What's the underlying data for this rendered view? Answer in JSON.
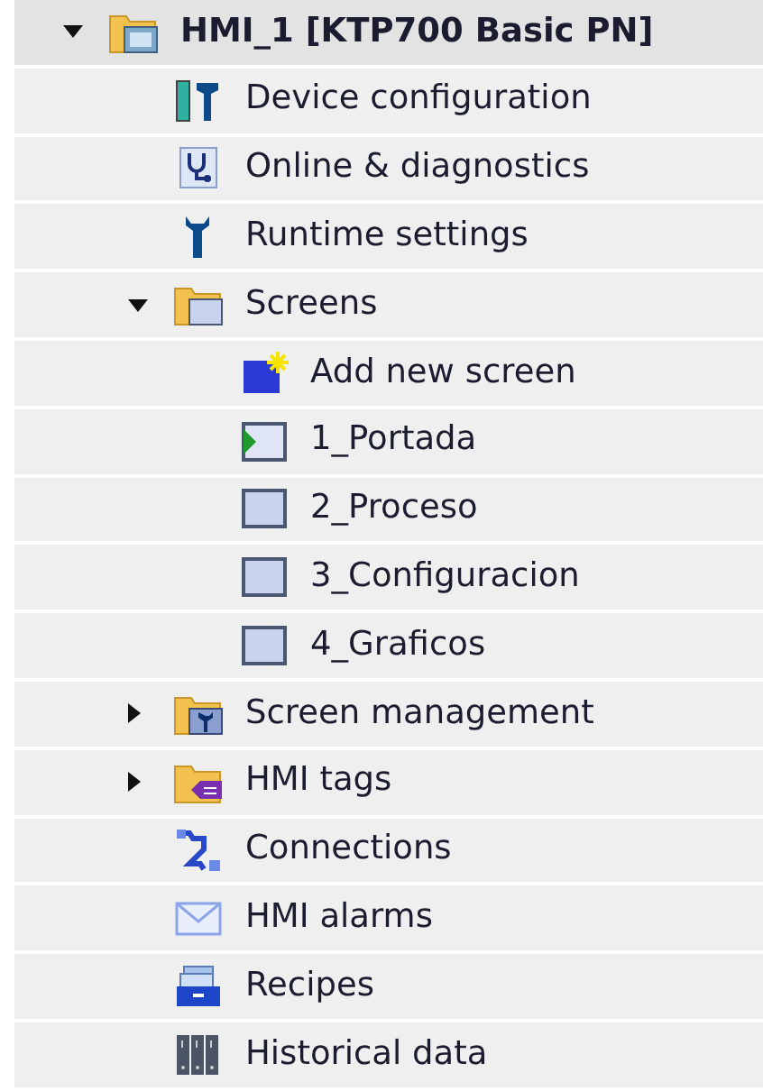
{
  "tree": [
    {
      "label": "HMI_1 [KTP700 Basic PN]",
      "kind": "device-folder",
      "expanded": true,
      "selected": true,
      "children": [
        {
          "label": "Device configuration",
          "kind": "device-config",
          "selected": false
        },
        {
          "label": "Online & diagnostics",
          "kind": "diagnostics",
          "selected": false
        },
        {
          "label": "Runtime settings",
          "kind": "wrench",
          "selected": false
        },
        {
          "label": "Screens",
          "kind": "screen-folder",
          "expanded": true,
          "selected": false,
          "children": [
            {
              "label": "Add new screen",
              "kind": "add-screen",
              "selected": false
            },
            {
              "label": "1_Portada",
              "kind": "start-screen",
              "selected": false
            },
            {
              "label": "2_Proceso",
              "kind": "screen",
              "selected": false
            },
            {
              "label": "3_Configuracion",
              "kind": "screen",
              "selected": false
            },
            {
              "label": "4_Graficos",
              "kind": "screen",
              "selected": false
            }
          ]
        },
        {
          "label": "Screen management",
          "kind": "tools-folder",
          "expanded": false,
          "selected": false
        },
        {
          "label": "HMI tags",
          "kind": "tags-folder",
          "expanded": false,
          "selected": false
        },
        {
          "label": "Connections",
          "kind": "connections",
          "selected": false
        },
        {
          "label": "HMI alarms",
          "kind": "alarms",
          "selected": false
        },
        {
          "label": "Recipes",
          "kind": "recipes",
          "selected": false
        },
        {
          "label": "Historical data",
          "kind": "history",
          "selected": false
        }
      ]
    }
  ]
}
